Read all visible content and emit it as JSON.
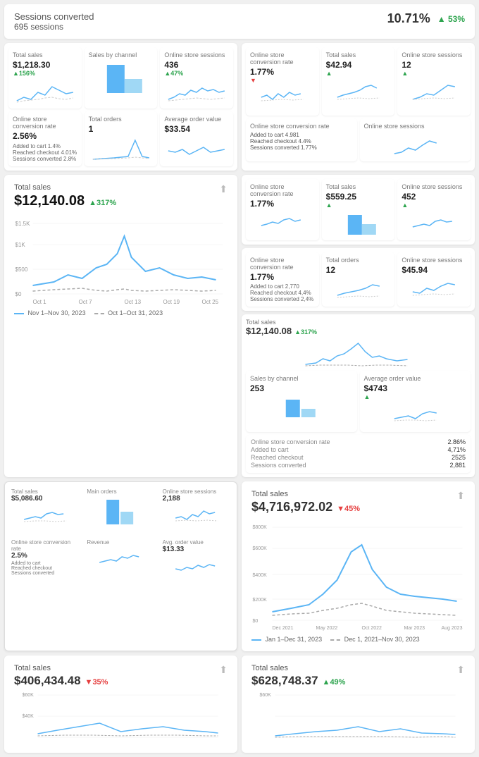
{
  "sessions": {
    "title": "Sessions converted",
    "count": "695 sessions",
    "pct": "10.71%",
    "badge": "53%",
    "badge_direction": "up"
  },
  "metrics_top": [
    {
      "label": "Total sales",
      "value": "$1,218.30",
      "change": "+156%",
      "dir": "up"
    },
    {
      "label": "Sales by channel",
      "value": "",
      "change": "",
      "dir": "neutral",
      "bar": true
    },
    {
      "label": "Online store sessions",
      "value": "436",
      "change": "+47%",
      "dir": "up"
    }
  ],
  "metrics_bottom": [
    {
      "label": "Online store conversion rate",
      "value": "2.56%",
      "rows": [
        "Added to cart 1.4%",
        "Reached checkout 4.01%",
        "Sessions converted 2.8%"
      ]
    },
    {
      "label": "Total orders",
      "value": "1",
      "change": ""
    },
    {
      "label": "Average order value",
      "value": "$33.54",
      "change": ""
    }
  ],
  "total_sales_1": {
    "title": "Total sales",
    "amount": "$12,140.08",
    "badge": "317%",
    "badge_dir": "up",
    "y_labels": [
      "$1.5K",
      "$1K",
      "$500",
      "$0"
    ],
    "x_labels": [
      "Oct 1",
      "Oct 7",
      "Oct 13",
      "Oct 19",
      "Oct 25"
    ],
    "legend_current": "Nov 1–Nov 30, 2023",
    "legend_prev": "Oct 1–Oct 31, 2023"
  },
  "right_top_sections": [
    {
      "rows": [
        {
          "label": "Online store conversion rate",
          "value": "1.77%",
          "dir": "down"
        },
        {
          "label": "Total sales",
          "value": "$42.94",
          "dir": "up"
        },
        {
          "label": "Online store sessions",
          "value": "12",
          "dir": "up"
        }
      ]
    },
    {
      "rows": [
        {
          "label": "Added to cart",
          "value": "4,981",
          "dir": ""
        },
        {
          "label": "Reached checkout",
          "value": "4.4%",
          "dir": ""
        },
        {
          "label": "Sessions converted",
          "value": "1.77%",
          "dir": ""
        }
      ]
    }
  ],
  "right_mid_sections": [
    {
      "label": "Online store conversion rate",
      "value": "1.77%",
      "badge_dir": "up"
    },
    {
      "label": "Total sales",
      "value": "$559.25",
      "badge_dir": "up"
    },
    {
      "label": "Online store sessions",
      "value": "452",
      "badge_dir": "up"
    }
  ],
  "right_mid2_sections": [
    {
      "label": "Online store conversion rate",
      "value": "1.77%"
    },
    {
      "label": "Total orders",
      "value": "12"
    },
    {
      "label": "Online store sessions",
      "value": "$45.94"
    }
  ],
  "total_sales_2": {
    "title": "Total sales",
    "amount": "$12,140.08",
    "badge": "317%",
    "badge_dir": "up"
  },
  "right_bottom_sections": [
    {
      "label": "Sales by channel",
      "value": "253",
      "badge_dir": "up"
    },
    {
      "label": "Average order value",
      "value": "$4743",
      "badge_dir": "up"
    }
  ],
  "right_conv": {
    "label": "Online store conversion rate",
    "value": "2.86%",
    "rows": [
      {
        "label": "Added to cart",
        "val": "4,71%"
      },
      {
        "label": "Reached checkout",
        "val": "2525"
      },
      {
        "label": "Sessions converted",
        "val": "2,881"
      }
    ]
  },
  "large_total_sales": {
    "title": "Total sales",
    "amount": "$4,716,972.02",
    "badge": "45%",
    "badge_dir": "down",
    "y_labels": [
      "$800K",
      "$600K",
      "$400K",
      "$200K",
      "$0"
    ],
    "x_labels": [
      "Dec 2021",
      "May 2022",
      "Oct 2022",
      "Mar 2023",
      "Aug 2023"
    ],
    "legend_current": "Jan 1–Dec 31, 2023",
    "legend_prev": "Dec 1, 2021–Nov 30, 2023"
  },
  "bottom_left": {
    "title": "Total sales",
    "amount": "$406,434.48",
    "badge": "35%",
    "badge_dir": "down",
    "y_labels": [
      "$60K",
      "$40K"
    ]
  },
  "bottom_right": {
    "title": "Total sales",
    "amount": "$628,748.37",
    "badge": "49%",
    "badge_dir": "up",
    "y_labels": [
      "$60K"
    ]
  }
}
